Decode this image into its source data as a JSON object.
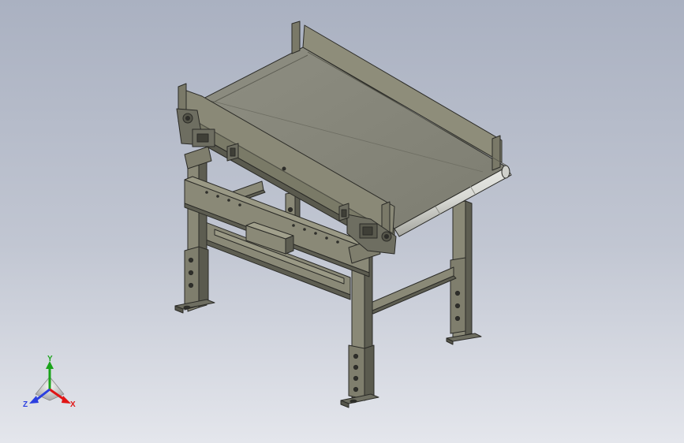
{
  "scene": {
    "subject": "conveyor",
    "colors": {
      "frame_light": "#8a8977",
      "frame_mid": "#727160",
      "frame_dark": "#55554a",
      "belt": "#85857a",
      "belt_light": "#9c9c8f",
      "edge": "#2b2b27",
      "roller": "#e3e4e0",
      "background_top": "#aab1c1",
      "background_bottom": "#e4e6ec"
    }
  },
  "triad": {
    "y_label": "Y",
    "x_label": "X",
    "z_label": "Z",
    "y_color": "#1aa31a",
    "x_color": "#e01515",
    "z_color": "#2b3fe0"
  }
}
